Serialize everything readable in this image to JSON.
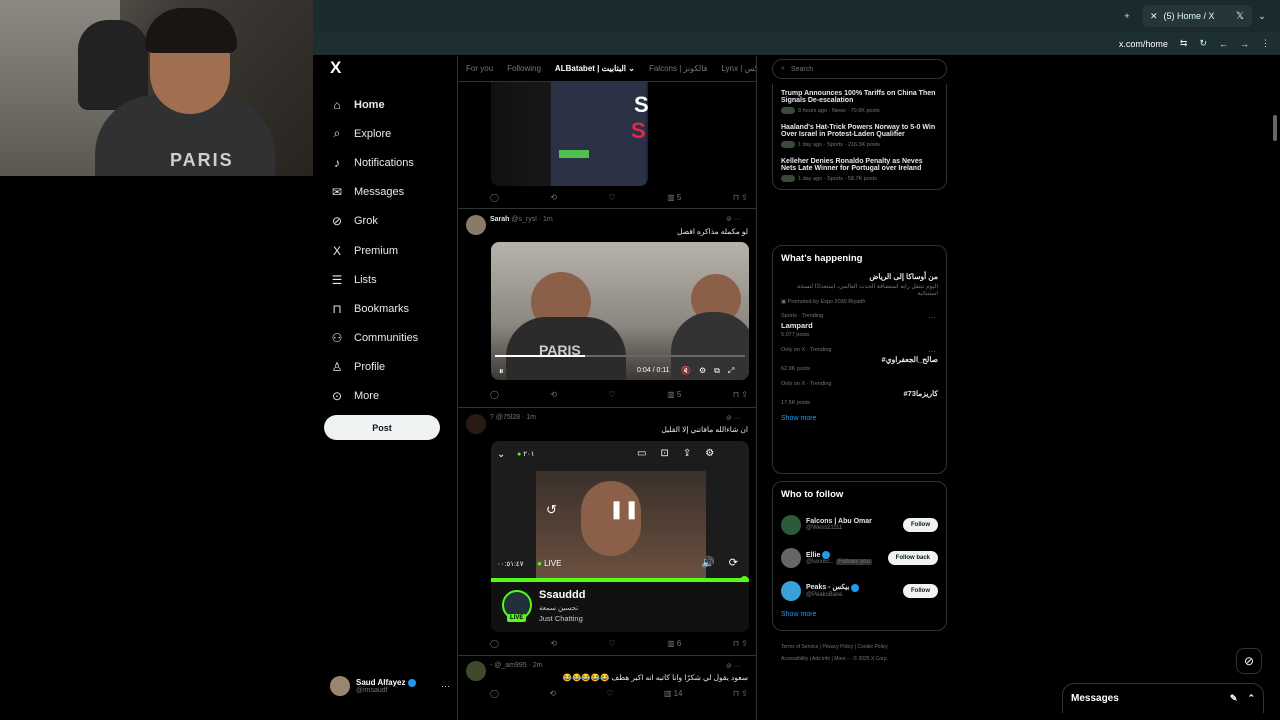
{
  "browser": {
    "tab_title": "(5) Home / X",
    "url": "x.com/home"
  },
  "nav": {
    "logo": "X",
    "items": [
      {
        "label": "Home",
        "icon": "home-icon",
        "glyph": "⌂"
      },
      {
        "label": "Explore",
        "icon": "search-icon",
        "glyph": "⌕"
      },
      {
        "label": "Notifications",
        "icon": "bell-icon",
        "glyph": "♪"
      },
      {
        "label": "Messages",
        "icon": "mail-icon",
        "glyph": "✉"
      },
      {
        "label": "Grok",
        "icon": "grok-icon",
        "glyph": "⊘"
      },
      {
        "label": "Premium",
        "icon": "x-premium-icon",
        "glyph": "X"
      },
      {
        "label": "Lists",
        "icon": "list-icon",
        "glyph": "☰"
      },
      {
        "label": "Bookmarks",
        "icon": "bookmark-icon",
        "glyph": "⊓"
      },
      {
        "label": "Communities",
        "icon": "people-icon",
        "glyph": "⚇"
      },
      {
        "label": "Profile",
        "icon": "person-icon",
        "glyph": "♙"
      },
      {
        "label": "More",
        "icon": "more-circle-icon",
        "glyph": "⊙"
      }
    ],
    "post_label": "Post",
    "account": {
      "name": "Saud Alfayez",
      "handle": "@imsaudf"
    }
  },
  "feed": {
    "tabs": [
      "For you",
      "Following",
      "ALBatabet | البتابيت",
      "Falcons | فالكونز",
      "Lynx | لينكس"
    ],
    "tweet1": {
      "views": "5"
    },
    "tweet2": {
      "name": "Sarah",
      "handle": "@s_rysl · 1m",
      "text": "لو مكمله مذاكره افضل",
      "time": "0:04 / 0:11",
      "views": "5"
    },
    "tweet3": {
      "handle": "? @75l28 · 1m",
      "text": "ان شاءالله مافاتني إلا القليل",
      "live_viewers": "٢٠١",
      "elapsed": "٠٠:٥١:٤٧",
      "live_label": "LIVE",
      "streamer": "Ssauddd",
      "stream_sub": "تحسين سمعة",
      "category": "Just Chatting",
      "views": "6"
    },
    "tweet4": {
      "handle": "- @_am995 · 2m",
      "text": "سعود يقول لي شكرًا وانا كاتبه انه اكبر هطف 😂😂😂😂😂",
      "views": "14"
    }
  },
  "right": {
    "search_placeholder": "Search",
    "news": [
      {
        "title": "Trump Announces 100% Tariffs on China Then Signals De-escalation",
        "meta": "8 hours ago · News · 70.6K posts"
      },
      {
        "title": "Haaland's Hat-Trick Powers Norway to 5-0 Win Over Israel in Protest-Laden Qualifier",
        "meta": "1 day ago · Sports · 216.3K posts"
      },
      {
        "title": "Kelleher Denies Ronaldo Penalty as Neves Nets Late Winner for Portugal over Ireland",
        "meta": "1 day ago · Sports · 58.7K posts"
      }
    ],
    "happening_title": "What's happening",
    "promo": {
      "title": "من أوساكا إلى الرياض",
      "body": "اليوم تنتقل راية استضافة الحدث العالمي، استعدادًا لنسخة استثنائية",
      "promoted": "Promoted by Expo 2030 Riyadh"
    },
    "trends": [
      {
        "category": "Sports · Trending",
        "name": "Lampard",
        "count": "5,077 posts"
      },
      {
        "category": "Only on X · Trending",
        "name": "#صالح_الجعفراوي",
        "count": "62.9K posts"
      },
      {
        "category": "Only on X · Trending",
        "name": "#كاريزما73",
        "count": "17.5K posts"
      }
    ],
    "show_more": "Show more",
    "wtf_title": "Who to follow",
    "follow": [
      {
        "name": "Falcons | Abu Omar",
        "handle": "@Wess21111",
        "btn": "Follow"
      },
      {
        "name": "Ellie",
        "handle": "@luxxiEl...",
        "extra": "Follows you",
        "btn": "Follow back"
      },
      {
        "name": "Peaks - بيكس",
        "handle": "@PeaksBase",
        "btn": "Follow"
      }
    ],
    "footer": [
      "Terms of Service",
      "Privacy Policy",
      "Cookie Policy",
      "Accessibility",
      "Ads info",
      "More ···",
      "© 2025 X Corp."
    ]
  },
  "messages": {
    "label": "Messages"
  }
}
